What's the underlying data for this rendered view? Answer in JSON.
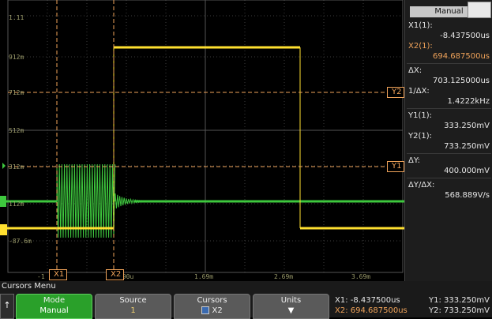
{
  "scope": {
    "y_labels": [
      "1.11",
      "912m",
      "712m",
      "512m",
      "312m",
      "112m",
      "-87.6m"
    ],
    "x_labels": [
      "-1",
      "690u",
      "1.69m",
      "2.69m",
      "3.69m"
    ],
    "cursor_tags": {
      "x1": "X1",
      "x2": "X2",
      "y1": "Y1",
      "y2": "Y2"
    },
    "channel_markers": {
      "ch1": "1",
      "ch2": "2"
    }
  },
  "panel": {
    "mode": "Manual",
    "x1_label": "X1(1):",
    "x1_value": "-8.437500us",
    "x2_label": "X2(1):",
    "x2_value": "694.687500us",
    "dx_label": "ΔX:",
    "dx_value": "703.125000us",
    "inv_dx_label": "1/ΔX:",
    "inv_dx_value": "1.4222kHz",
    "y1_label": "Y1(1):",
    "y1_value": "333.250mV",
    "y2_label": "Y2(1):",
    "y2_value": "733.250mV",
    "dy_label": "ΔY:",
    "dy_value": "400.000mV",
    "dydx_label": "ΔY/ΔX:",
    "dydx_value": "568.889V/s"
  },
  "menu": {
    "title": "Cursors Menu",
    "mode_label": "Mode",
    "mode_value": "Manual",
    "source_label": "Source",
    "source_value": "1",
    "cursors_label": "Cursors",
    "cursors_value": "X2",
    "units_label": "Units",
    "return_glyph": "↑",
    "units_glyph": "▼"
  },
  "readout": {
    "x1": "X1:  -8.437500us",
    "x2": "X2:  694.687500us",
    "y1": "Y1: 333.250mV",
    "y2": "Y2: 733.250mV"
  },
  "colors": {
    "trace_green": "#3ec83e",
    "trace_yellow": "#ffe030",
    "cursor_orange": "#f0a35a",
    "grid": "#3c3c3c",
    "softkey_active": "#2aa02a"
  }
}
